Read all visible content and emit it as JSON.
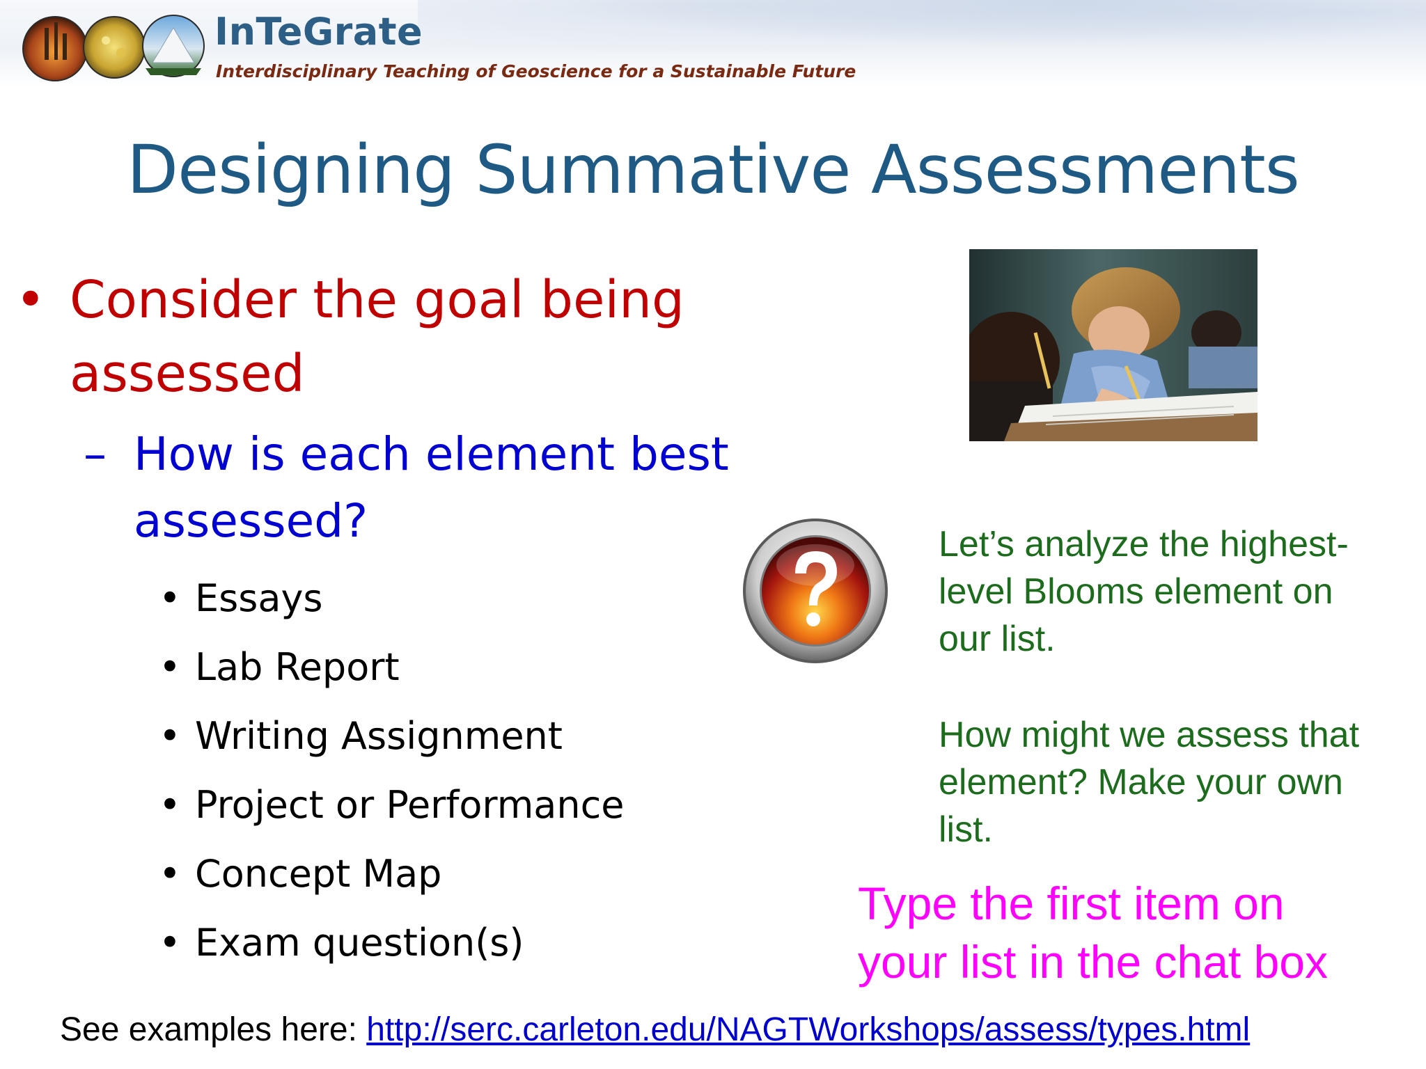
{
  "header": {
    "brand_title": "InTeGrate",
    "brand_subtitle": "Interdisciplinary Teaching of Geoscience for a Sustainable Future"
  },
  "slide": {
    "title": "Designing Summative Assessments",
    "bullet_level1": "Consider the goal being assessed",
    "bullet_level2": "How is each element best assessed?",
    "bullet_level3": [
      "Essays",
      "Lab Report",
      "Writing Assignment",
      "Project or Performance",
      "Concept Map",
      "Exam question(s)"
    ],
    "bullet_glyph": "•",
    "dash_glyph": "–",
    "prompt_line1": "Let’s analyze the highest-level Blooms element on our list.",
    "prompt_line2": "How might we assess that element?  Make your own list.",
    "chat_prompt_1": "Type the first item on",
    "chat_prompt_2": "your list in the chat box",
    "footer_prefix": "See examples here: ",
    "footer_link": "http://serc.carleton.edu/NAGTWorkshops/assess/types.html"
  },
  "colors": {
    "title": "#1f5a85",
    "level1": "#c00000",
    "level2": "#0000d0",
    "prompt_green": "#1d6b1d",
    "chat_magenta": "#ff00ff",
    "link": "#0000cc"
  },
  "icons": {
    "logo": "integrate-logo-circles-icon",
    "question": "question-mark-icon",
    "photo": "students-writing-photo"
  }
}
